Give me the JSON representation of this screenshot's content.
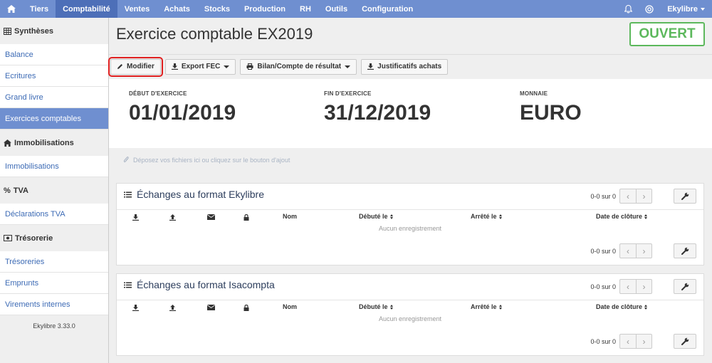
{
  "nav": {
    "items": [
      "Tiers",
      "Comptabilité",
      "Ventes",
      "Achats",
      "Stocks",
      "Production",
      "RH",
      "Outils",
      "Configuration"
    ],
    "user": "Ekylibre"
  },
  "sidebar": {
    "sections": [
      {
        "title": "Synthèses",
        "icon": "table-icon",
        "items": [
          "Balance",
          "Ecritures",
          "Grand livre",
          "Exercices comptables"
        ]
      },
      {
        "title": "Immobilisations",
        "icon": "home-icon",
        "items": [
          "Immobilisations"
        ]
      },
      {
        "title": "TVA",
        "icon": "percent-icon",
        "items": [
          "Déclarations TVA"
        ]
      },
      {
        "title": "Trésorerie",
        "icon": "money-icon",
        "items": [
          "Trésoreries",
          "Emprunts",
          "Virements internes"
        ]
      }
    ],
    "version": "Ekylibre 3.33.0"
  },
  "page": {
    "title": "Exercice comptable EX2019",
    "status": "OUVERT"
  },
  "toolbar": {
    "modifier": "Modifier",
    "export_fec": "Export FEC",
    "bilan": "Bilan/Compte de résultat",
    "justificatifs": "Justificatifs achats"
  },
  "info": {
    "start_label": "DÉBUT D'EXERCICE",
    "start_value": "01/01/2019",
    "end_label": "FIN D'EXERCICE",
    "end_value": "31/12/2019",
    "currency_label": "MONNAIE",
    "currency_value": "EURO"
  },
  "dropzone": "Déposez vos fichiers ici ou cliquez sur le bouton d'ajout",
  "panels": [
    {
      "title": "Échanges au format Ekylibre",
      "pager": "0-0 sur 0",
      "columns": {
        "nom": "Nom",
        "debute": "Débuté le",
        "arrete": "Arrêté le",
        "cloture": "Date de clôture"
      },
      "empty": "Aucun enregistrement"
    },
    {
      "title": "Échanges au format Isacompta",
      "pager": "0-0 sur 0",
      "columns": {
        "nom": "Nom",
        "debute": "Débuté le",
        "arrete": "Arrêté le",
        "cloture": "Date de clôture"
      },
      "empty": "Aucun enregistrement"
    }
  ],
  "colors": {
    "nav": "#6f8fd0",
    "nav_active": "#4d6fb8",
    "status": "#5cb85c",
    "highlight": "#e02020"
  }
}
